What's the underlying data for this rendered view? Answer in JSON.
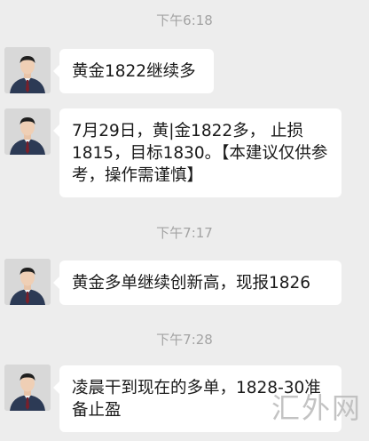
{
  "messages": [
    {
      "time": "下午6:18",
      "text": "黄金1822继续多"
    },
    {
      "time": "",
      "text": "7月29日，黄|金1822多， 止损1815，目标1830。【本建议仅供参考，操作需谨慎】"
    },
    {
      "time": "下午7:17",
      "text": "黄金多单继续创新高，现报1826"
    },
    {
      "time": "下午7:28",
      "text": "凌晨干到现在的多单，1828-30准备止盈"
    }
  ],
  "avatar": {
    "icon": "person-avatar-icon",
    "suit_color": "#2c3a55",
    "tie_color": "#7a1f2a"
  },
  "watermark": "汇外网",
  "colors": {
    "background": "#ededed",
    "bubble": "#ffffff",
    "time_text": "#a3a3a3"
  }
}
